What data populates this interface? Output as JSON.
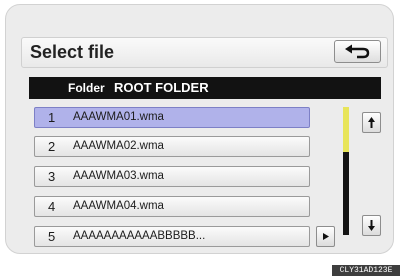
{
  "header": {
    "title": "Select file"
  },
  "folder": {
    "label": "Folder",
    "name": "ROOT FOLDER"
  },
  "files": [
    {
      "num": "1",
      "name": "AAAWMA01.wma",
      "selected": true
    },
    {
      "num": "2",
      "name": "AAAWMA02.wma",
      "selected": false
    },
    {
      "num": "3",
      "name": "AAAWMA03.wma",
      "selected": false
    },
    {
      "num": "4",
      "name": "AAAWMA04.wma",
      "selected": false
    },
    {
      "num": "5",
      "name": "AAAAAAAAAAABBBBB...",
      "selected": false
    }
  ],
  "icons": {
    "back": "return-arrow-icon",
    "scroll_up": "scroll-up-icon",
    "scroll_down": "scroll-down-icon",
    "expand": "play-right-icon"
  },
  "colors": {
    "selected_row": "#b0b2ea",
    "scroll_thumb": "#e8e55a",
    "folder_bar": "#121212"
  },
  "scroll": {
    "thumb_fraction": 0.35
  },
  "caption": "CLY31AD123E"
}
